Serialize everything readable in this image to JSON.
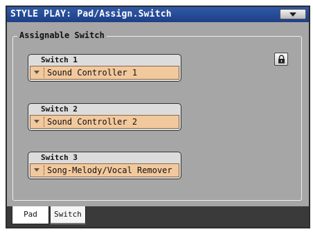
{
  "window": {
    "title": "STYLE PLAY: Pad/Assign.Switch",
    "menu_icon": "chevron-down-icon"
  },
  "panel": {
    "group_title": "Assignable Switch",
    "lock_icon": "lock-icon",
    "switches": [
      {
        "label": "Switch 1",
        "value": "Sound Controller 1"
      },
      {
        "label": "Switch 2",
        "value": "Sound Controller 2"
      },
      {
        "label": "Switch 3",
        "value": "Song-Melody/Vocal Remover"
      }
    ]
  },
  "tabs": [
    {
      "label": "Pad",
      "active": false
    },
    {
      "label": "Switch",
      "active": true
    }
  ],
  "colors": {
    "title_bar": "#2f5aa8",
    "panel_bg": "#a6a6a6",
    "dropdown_bg": "#f2c89d",
    "tab_bar": "#3a3a3a"
  }
}
